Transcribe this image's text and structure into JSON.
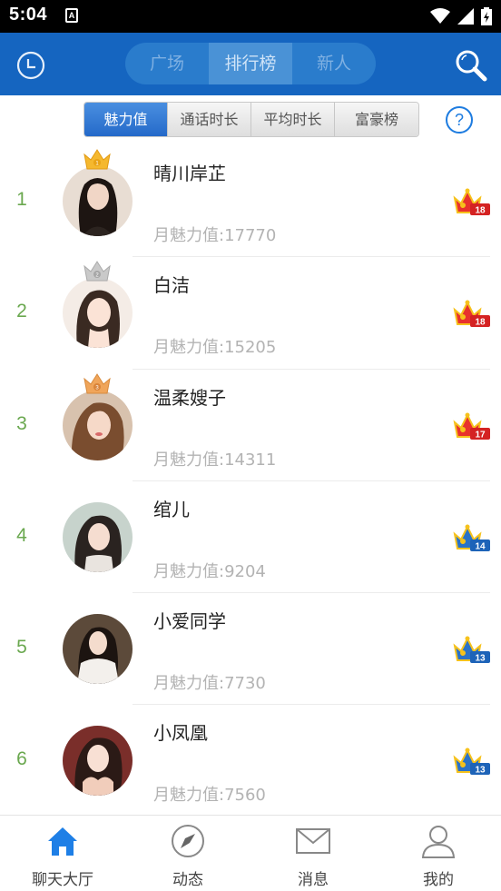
{
  "status_bar": {
    "time": "5:04",
    "notification_icon": "A"
  },
  "header": {
    "tabs": [
      {
        "label": "广场",
        "active": false
      },
      {
        "label": "排行榜",
        "active": true
      },
      {
        "label": "新人",
        "active": false
      }
    ],
    "accent_color": "#1565c0"
  },
  "rank_tabs": [
    {
      "label": "魅力值",
      "active": true
    },
    {
      "label": "通话时长",
      "active": false
    },
    {
      "label": "平均时长",
      "active": false
    },
    {
      "label": "富豪榜",
      "active": false
    }
  ],
  "help_label": "?",
  "rankings": [
    {
      "rank": "1",
      "name": "晴川岸芷",
      "charm": "月魅力值:17770",
      "medal": "gold",
      "level": "18"
    },
    {
      "rank": "2",
      "name": "白洁",
      "charm": "月魅力值:15205",
      "medal": "silver",
      "level": "18"
    },
    {
      "rank": "3",
      "name": "温柔嫂子",
      "charm": "月魅力值:14311",
      "medal": "bronze",
      "level": "17"
    },
    {
      "rank": "4",
      "name": "绾儿",
      "charm": "月魅力值:9204",
      "medal": "",
      "level": "14"
    },
    {
      "rank": "5",
      "name": "小爱同学",
      "charm": "月魅力值:7730",
      "medal": "",
      "level": "13"
    },
    {
      "rank": "6",
      "name": "小凤凰",
      "charm": "月魅力值:7560",
      "medal": "",
      "level": "13"
    }
  ],
  "bottom_nav": [
    {
      "label": "聊天大厅",
      "icon": "home-icon",
      "active": true
    },
    {
      "label": "动态",
      "icon": "compass-icon",
      "active": false
    },
    {
      "label": "消息",
      "icon": "mail-icon",
      "active": false
    },
    {
      "label": "我的",
      "icon": "user-icon",
      "active": false
    }
  ]
}
